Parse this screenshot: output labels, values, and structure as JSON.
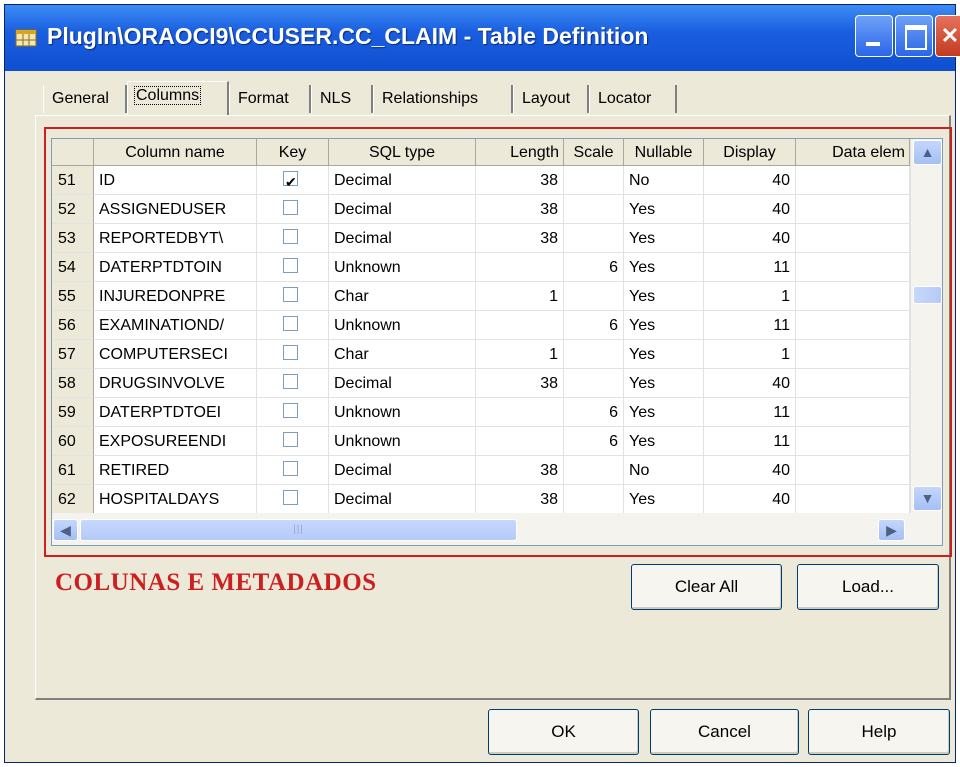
{
  "window": {
    "title": "PlugIn\\ORAOCI9\\CCUSER.CC_CLAIM - Table Definition"
  },
  "tabs": [
    {
      "label": "General"
    },
    {
      "label": "Columns"
    },
    {
      "label": "Format"
    },
    {
      "label": "NLS"
    },
    {
      "label": "Relationships"
    },
    {
      "label": "Layout"
    },
    {
      "label": "Locator"
    }
  ],
  "active_tab": "Columns",
  "grid": {
    "headers": {
      "column_name": "Column name",
      "key": "Key",
      "sql_type": "SQL type",
      "length": "Length",
      "scale": "Scale",
      "nullable": "Nullable",
      "display": "Display",
      "data_element": "Data elem"
    },
    "rows": [
      {
        "n": "51",
        "name": "ID",
        "key": true,
        "type": "Decimal",
        "length": "38",
        "scale": "",
        "nullable": "No",
        "display": "40"
      },
      {
        "n": "52",
        "name": "ASSIGNEDUSER",
        "key": false,
        "type": "Decimal",
        "length": "38",
        "scale": "",
        "nullable": "Yes",
        "display": "40"
      },
      {
        "n": "53",
        "name": "REPORTEDBYT\\",
        "key": false,
        "type": "Decimal",
        "length": "38",
        "scale": "",
        "nullable": "Yes",
        "display": "40"
      },
      {
        "n": "54",
        "name": "DATERPTDTOIN",
        "key": false,
        "type": "Unknown",
        "length": "",
        "scale": "6",
        "nullable": "Yes",
        "display": "11"
      },
      {
        "n": "55",
        "name": "INJUREDONPRE",
        "key": false,
        "type": "Char",
        "length": "1",
        "scale": "",
        "nullable": "Yes",
        "display": "1"
      },
      {
        "n": "56",
        "name": "EXAMINATIOND/",
        "key": false,
        "type": "Unknown",
        "length": "",
        "scale": "6",
        "nullable": "Yes",
        "display": "11"
      },
      {
        "n": "57",
        "name": "COMPUTERSECI",
        "key": false,
        "type": "Char",
        "length": "1",
        "scale": "",
        "nullable": "Yes",
        "display": "1"
      },
      {
        "n": "58",
        "name": "DRUGSINVOLVE",
        "key": false,
        "type": "Decimal",
        "length": "38",
        "scale": "",
        "nullable": "Yes",
        "display": "40"
      },
      {
        "n": "59",
        "name": "DATERPTDTOEI",
        "key": false,
        "type": "Unknown",
        "length": "",
        "scale": "6",
        "nullable": "Yes",
        "display": "11"
      },
      {
        "n": "60",
        "name": "EXPOSUREENDI",
        "key": false,
        "type": "Unknown",
        "length": "",
        "scale": "6",
        "nullable": "Yes",
        "display": "11"
      },
      {
        "n": "61",
        "name": "RETIRED",
        "key": false,
        "type": "Decimal",
        "length": "38",
        "scale": "",
        "nullable": "No",
        "display": "40"
      },
      {
        "n": "62",
        "name": "HOSPITALDAYS",
        "key": false,
        "type": "Decimal",
        "length": "38",
        "scale": "",
        "nullable": "Yes",
        "display": "40"
      }
    ]
  },
  "caption": "COLUNAS E METADADOS",
  "buttons": {
    "clear_all": "Clear All",
    "load": "Load...",
    "ok": "OK",
    "cancel": "Cancel",
    "help": "Help"
  },
  "colors": {
    "title_bar": "#1a5fe0",
    "highlight_box": "#cc2020",
    "dialog_bg": "#ece9d8"
  }
}
